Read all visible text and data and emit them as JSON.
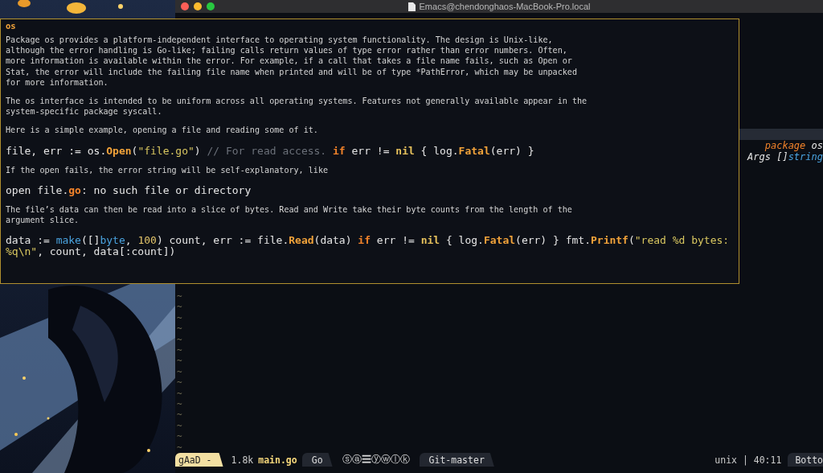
{
  "window": {
    "title": "Emacs@chendonghaos-MacBook-Pro.local"
  },
  "editor": {
    "lines": [
      {
        "current": true
      },
      {
        "current": false,
        "segments": [
          {
            "text": "package",
            "kind": "keyword"
          },
          {
            "text": " os",
            "kind": "ident"
          }
        ]
      },
      {
        "current": false,
        "segments": [
          {
            "text": "Args []",
            "kind": "ident"
          },
          {
            "text": "string",
            "kind": "type"
          }
        ]
      }
    ],
    "tildes": [
      "~",
      "~",
      "~",
      "~",
      "~",
      "~",
      "~",
      "~",
      "~",
      "~",
      "~",
      "~",
      "~",
      "~",
      "~"
    ]
  },
  "popup": {
    "title": "os",
    "blocks": [
      {
        "kind": "prose",
        "text": "Package os provides a platform-independent interface to operating system functionality. The design is Unix-like,\nalthough the error handling is Go-like; failing calls return values of type error rather than error numbers. Often,\nmore information is available within the error. For example, if a call that takes a file name fails, such as Open or\nStat, the error will include the failing file name when printed and will be of type *PathError, which may be unpacked\nfor more information."
      },
      {
        "kind": "prose",
        "text": "The os interface is intended to be uniform across all operating systems. Features not generally available appear in the\nsystem-specific package syscall."
      },
      {
        "kind": "prose",
        "text": "Here is a simple example, opening a file and reading some of it."
      },
      {
        "kind": "code",
        "segments": [
          {
            "text": "file, err := os.",
            "kind": "plain"
          },
          {
            "text": "Open",
            "kind": "func"
          },
          {
            "text": "(",
            "kind": "plain"
          },
          {
            "text": "\"file.go\"",
            "kind": "string"
          },
          {
            "text": ") ",
            "kind": "plain"
          },
          {
            "text": "// For read access. ",
            "kind": "comment"
          },
          {
            "text": "if",
            "kind": "keyword"
          },
          {
            "text": " err != ",
            "kind": "plain"
          },
          {
            "text": "nil",
            "kind": "constant"
          },
          {
            "text": " { log.",
            "kind": "plain"
          },
          {
            "text": "Fatal",
            "kind": "func"
          },
          {
            "text": "(err) }",
            "kind": "plain"
          }
        ]
      },
      {
        "kind": "prose",
        "text": "If the open fails, the error string will be self-explanatory, like"
      },
      {
        "kind": "code",
        "segments": [
          {
            "text": "open file.",
            "kind": "plain"
          },
          {
            "text": "go",
            "kind": "keyword"
          },
          {
            "text": ": no such file or directory",
            "kind": "plain"
          }
        ]
      },
      {
        "kind": "prose",
        "text": "The file’s data can then be read into a slice of bytes. Read and Write take their byte counts from the length of the\nargument slice."
      },
      {
        "kind": "code",
        "segments": [
          {
            "text": "data := ",
            "kind": "plain"
          },
          {
            "text": "make",
            "kind": "builtin"
          },
          {
            "text": "([]",
            "kind": "plain"
          },
          {
            "text": "byte",
            "kind": "type"
          },
          {
            "text": ", ",
            "kind": "plain"
          },
          {
            "text": "100",
            "kind": "number"
          },
          {
            "text": ") count, err := file.",
            "kind": "plain"
          },
          {
            "text": "Read",
            "kind": "func"
          },
          {
            "text": "(data) ",
            "kind": "plain"
          },
          {
            "text": "if",
            "kind": "keyword"
          },
          {
            "text": " err != ",
            "kind": "plain"
          },
          {
            "text": "nil",
            "kind": "constant"
          },
          {
            "text": " { log.",
            "kind": "plain"
          },
          {
            "text": "Fatal",
            "kind": "func"
          },
          {
            "text": "(err) } fmt.",
            "kind": "plain"
          },
          {
            "text": "Printf",
            "kind": "func"
          },
          {
            "text": "(",
            "kind": "plain"
          },
          {
            "text": "\"read %d bytes: %q\\n\"",
            "kind": "string"
          },
          {
            "text": ", count, data[:count])",
            "kind": "plain"
          }
        ]
      }
    ]
  },
  "mode_line": {
    "evil_state": "gAaD -",
    "buffer_size": "1.8k",
    "buffer_name": "main.go",
    "major_mode": "Go",
    "minor_modes": "ⓢⓐ☰ⓨⓦⓛⓚ",
    "vcs": "Git-master",
    "cursor": "unix | 40:11",
    "position": "Botto"
  }
}
